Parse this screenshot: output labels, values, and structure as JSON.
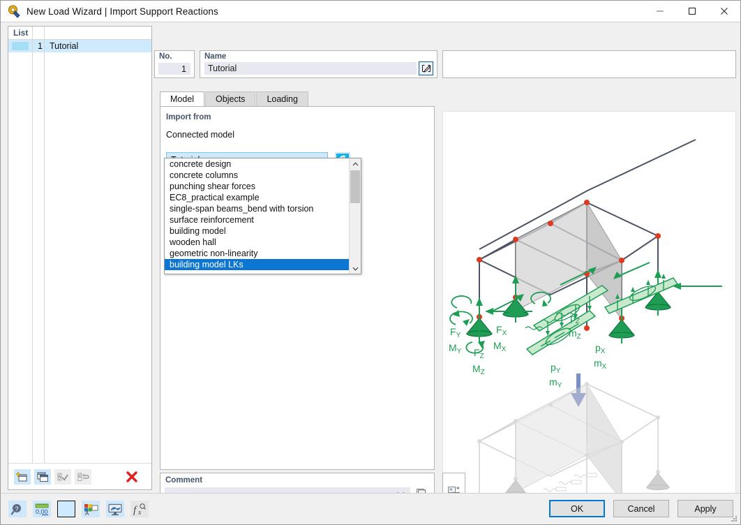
{
  "window": {
    "title": "New Load Wizard | Import Support Reactions",
    "icon": "wizard-icon",
    "minimize": "—",
    "maximize": "☐",
    "close": "✕"
  },
  "list_panel": {
    "header": "List",
    "rows": [
      {
        "no": "1",
        "name": "Tutorial"
      }
    ],
    "tools": [
      {
        "name": "new-item-button",
        "icon": "new-window-icon",
        "enabled": true
      },
      {
        "name": "copy-item-button",
        "icon": "copy-window-icon",
        "enabled": true
      },
      {
        "name": "select-all-button",
        "icon": "check-list-icon",
        "enabled": false
      },
      {
        "name": "invert-selection-button",
        "icon": "invert-list-icon",
        "enabled": false
      },
      {
        "name": "delete-item-button",
        "icon": "red-x-icon",
        "enabled": true
      }
    ]
  },
  "header_fields": {
    "no_label": "No.",
    "no_value": "1",
    "name_label": "Name",
    "name_value": "Tutorial",
    "name_placeholder": "",
    "edit_button_icon": "pencil-edit-icon"
  },
  "tabs": [
    {
      "label": "Model",
      "active": true
    },
    {
      "label": "Objects",
      "active": false
    },
    {
      "label": "Loading",
      "active": false
    }
  ],
  "model_tab": {
    "group_title": "Import from",
    "connected_model_label": "Connected model",
    "connected_model_value": "Tutorial",
    "refresh_icon": "refresh-circle-icon",
    "dropdown": {
      "open": true,
      "items": [
        "concrete design",
        "concrete columns",
        "punching shear forces",
        "EC8_practical example",
        "single-span beams_bend with torsion",
        "surface reinforcement",
        "building model",
        "wooden hall",
        "geometric non-linearity",
        "building model LKs"
      ],
      "selected": "building model LKs",
      "scroll_up_icon": "chevron-up-icon",
      "scroll_down_icon": "chevron-down-icon"
    }
  },
  "comment": {
    "label": "Comment",
    "value": "",
    "placeholder": "",
    "dropdown_icon": "chevron-down-icon",
    "copy_icon": "copy-pages-icon"
  },
  "graphic": {
    "tool_icon": "graphic-settings-icon",
    "top_model_labels": [
      "F",
      "Y",
      "M",
      "Y",
      "F",
      "Z",
      "M",
      "Z",
      "F",
      "X",
      "M",
      "X",
      "p",
      "Z",
      "m",
      "Z",
      "p",
      "Y",
      "m",
      "Y",
      "p",
      "X",
      "m",
      "X"
    ],
    "force_labels": [
      {
        "base": "F",
        "sub": "Y"
      },
      {
        "base": "M",
        "sub": "Y"
      },
      {
        "base": "F",
        "sub": "Z"
      },
      {
        "base": "M",
        "sub": "Z"
      },
      {
        "base": "F",
        "sub": "X"
      },
      {
        "base": "M",
        "sub": "X"
      },
      {
        "base": "p",
        "sub": "Z"
      },
      {
        "base": "m",
        "sub": "Z"
      },
      {
        "base": "p",
        "sub": "Y"
      },
      {
        "base": "m",
        "sub": "Y"
      },
      {
        "base": "p",
        "sub": "X"
      },
      {
        "base": "m",
        "sub": "X"
      }
    ]
  },
  "bottom_bar": {
    "tools": [
      {
        "name": "help-button",
        "icon": "question-magnifier-icon"
      },
      {
        "name": "units-button",
        "icon": "units-ruler-icon"
      },
      {
        "name": "color-swatch-button",
        "icon": "color-swatch-icon"
      },
      {
        "name": "display-properties-button",
        "icon": "display-properties-icon"
      },
      {
        "name": "rendering-button",
        "icon": "render-screen-icon"
      },
      {
        "name": "formula-button",
        "icon": "function-icon"
      }
    ],
    "buttons": [
      {
        "label": "OK",
        "name": "ok-button",
        "default": true
      },
      {
        "label": "Cancel",
        "name": "cancel-button",
        "default": false
      },
      {
        "label": "Apply",
        "name": "apply-button",
        "default": false
      }
    ]
  },
  "colors": {
    "accent": "#0d76d3",
    "selection": "#cfeafc",
    "label_blue": "#44546a",
    "green": "#1f9d55",
    "red_node": "#e03a1e",
    "arrow_blue": "#7a8fc4"
  }
}
